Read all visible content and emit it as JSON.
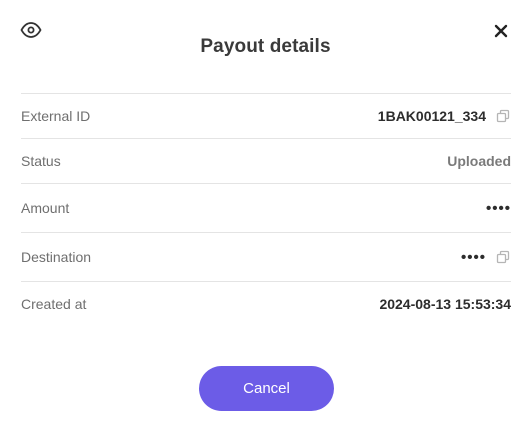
{
  "dialog": {
    "title": "Payout details",
    "view_icon": "eye-icon",
    "close_icon": "close-icon"
  },
  "details": [
    {
      "label": "External ID",
      "value": "1BAK00121_334",
      "copyable": true
    },
    {
      "label": "Status",
      "value": "Uploaded",
      "copyable": false
    },
    {
      "label": "Amount",
      "value": "••••",
      "copyable": false
    },
    {
      "label": "Destination",
      "value": "••••",
      "copyable": true
    },
    {
      "label": "Created at",
      "value": "2024-08-13 15:53:34",
      "copyable": false
    }
  ],
  "actions": {
    "cancel_label": "Cancel"
  },
  "colors": {
    "accent": "#6c5ce7",
    "divider": "#e4e4e4",
    "label_text": "#6f6f6f"
  }
}
